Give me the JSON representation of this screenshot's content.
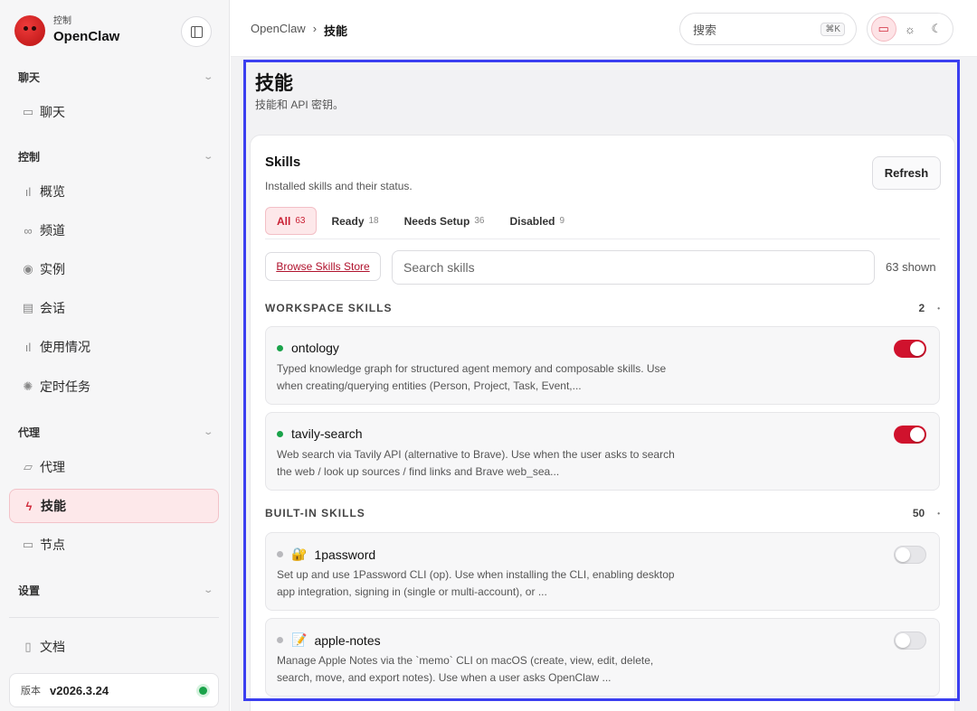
{
  "brand": {
    "sub": "控制",
    "name": "OpenClaw"
  },
  "sidebar": {
    "groups": [
      {
        "title": "聊天",
        "items": [
          {
            "label": "聊天",
            "icon": "chat-icon"
          }
        ]
      },
      {
        "title": "控制",
        "items": [
          {
            "label": "概览",
            "icon": "bar-chart-icon"
          },
          {
            "label": "频道",
            "icon": "link-icon"
          },
          {
            "label": "实例",
            "icon": "broadcast-icon"
          },
          {
            "label": "会话",
            "icon": "document-icon"
          },
          {
            "label": "使用情况",
            "icon": "bar-chart-icon"
          },
          {
            "label": "定时任务",
            "icon": "loader-icon"
          }
        ]
      },
      {
        "title": "代理",
        "items": [
          {
            "label": "代理",
            "icon": "folder-icon"
          },
          {
            "label": "技能",
            "icon": "lightning-icon",
            "active": true
          },
          {
            "label": "节点",
            "icon": "monitor-icon"
          }
        ]
      },
      {
        "title": "设置",
        "items": []
      }
    ],
    "docs_label": "文档",
    "version_label": "版本",
    "version_value": "v2026.3.24",
    "status_color": "#1aa34a"
  },
  "topbar": {
    "breadcrumb_root": "OpenClaw",
    "breadcrumb_sep": "›",
    "breadcrumb_current": "技能",
    "search_placeholder": "搜索",
    "search_shortcut": "⌘K"
  },
  "page": {
    "title": "技能",
    "subtitle": "技能和 API 密钥。"
  },
  "skills_card": {
    "title": "Skills",
    "subtitle": "Installed skills and their status.",
    "refresh_label": "Refresh",
    "tabs": [
      {
        "label": "All",
        "count": "63",
        "active": true
      },
      {
        "label": "Ready",
        "count": "18"
      },
      {
        "label": "Needs Setup",
        "count": "36"
      },
      {
        "label": "Disabled",
        "count": "9"
      }
    ],
    "store_link": "Browse Skills Store",
    "search_placeholder": "Search skills",
    "shown_count": "63 shown",
    "sections": [
      {
        "label": "WORKSPACE SKILLS",
        "count": "2",
        "skills": [
          {
            "name": "ontology",
            "emoji": "",
            "enabled": true,
            "desc_line1": "Typed knowledge graph for structured agent memory and composable skills. Use",
            "desc_line2": "when creating/querying entities (Person, Project, Task, Event,..."
          },
          {
            "name": "tavily-search",
            "emoji": "",
            "enabled": true,
            "desc_line1": "Web search via Tavily API (alternative to Brave). Use when the user asks to search",
            "desc_line2": "the web / look up sources / find links and Brave web_sea..."
          }
        ]
      },
      {
        "label": "BUILT-IN SKILLS",
        "count": "50",
        "skills": [
          {
            "name": "1password",
            "emoji": "🔐",
            "enabled": false,
            "desc_line1": "Set up and use 1Password CLI (op). Use when installing the CLI, enabling desktop",
            "desc_line2": "app integration, signing in (single or multi-account), or ..."
          },
          {
            "name": "apple-notes",
            "emoji": "📝",
            "enabled": false,
            "desc_line1": "Manage Apple Notes via the `memo` CLI on macOS (create, view, edit, delete,",
            "desc_line2": "search, move, and export notes). Use when a user asks OpenClaw ..."
          }
        ]
      }
    ]
  },
  "colors": {
    "accent": "#d0122d",
    "highlight_frame": "#3b3ff0"
  }
}
